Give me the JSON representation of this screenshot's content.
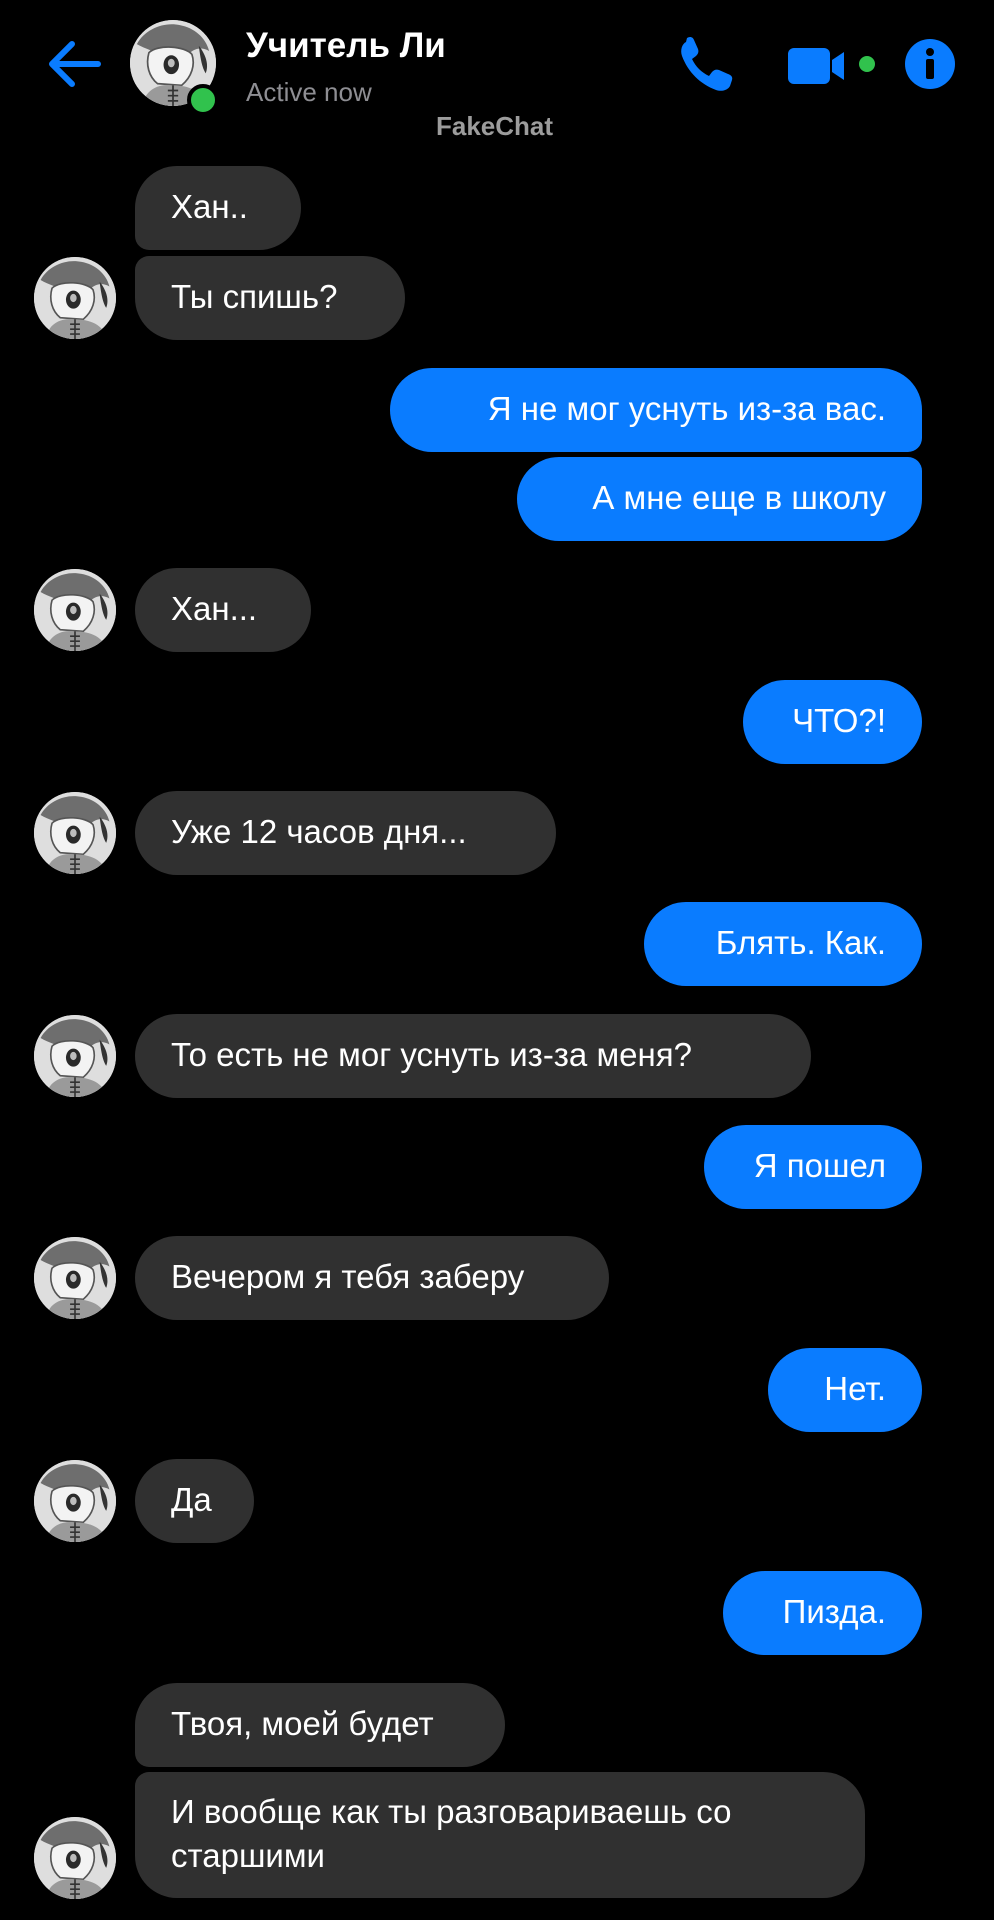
{
  "header": {
    "contact_name": "Учитель Ли",
    "status": "Active now",
    "watermark": "FakeChat"
  },
  "colors": {
    "accent": "#0a7cff",
    "incoming_bubble": "#303030",
    "online": "#31c24d",
    "background": "#000000"
  },
  "icons": {
    "back": "arrow-left-icon",
    "call": "phone-icon",
    "video": "video-camera-icon",
    "info": "info-icon"
  },
  "messages": [
    {
      "sender": "incoming",
      "text": "Хан.."
    },
    {
      "sender": "incoming",
      "text": "Ты спишь?"
    },
    {
      "sender": "outgoing",
      "text": "Я не мог уснуть из-за вас."
    },
    {
      "sender": "outgoing",
      "text": "А мне еще в школу"
    },
    {
      "sender": "incoming",
      "text": "Хан..."
    },
    {
      "sender": "outgoing",
      "text": "ЧТО?!"
    },
    {
      "sender": "incoming",
      "text": "Уже 12 часов дня..."
    },
    {
      "sender": "outgoing",
      "text": "Блять. Как."
    },
    {
      "sender": "incoming",
      "text": "То есть не мог уснуть из-за меня?"
    },
    {
      "sender": "outgoing",
      "text": "Я пошел"
    },
    {
      "sender": "incoming",
      "text": "Вечером я тебя заберу"
    },
    {
      "sender": "outgoing",
      "text": "Нет."
    },
    {
      "sender": "incoming",
      "text": "Да"
    },
    {
      "sender": "outgoing",
      "text": "Пизда."
    },
    {
      "sender": "incoming",
      "text": "Твоя, моей будет"
    },
    {
      "sender": "incoming",
      "text": "И вообще как ты разговариваешь со старшими"
    }
  ]
}
